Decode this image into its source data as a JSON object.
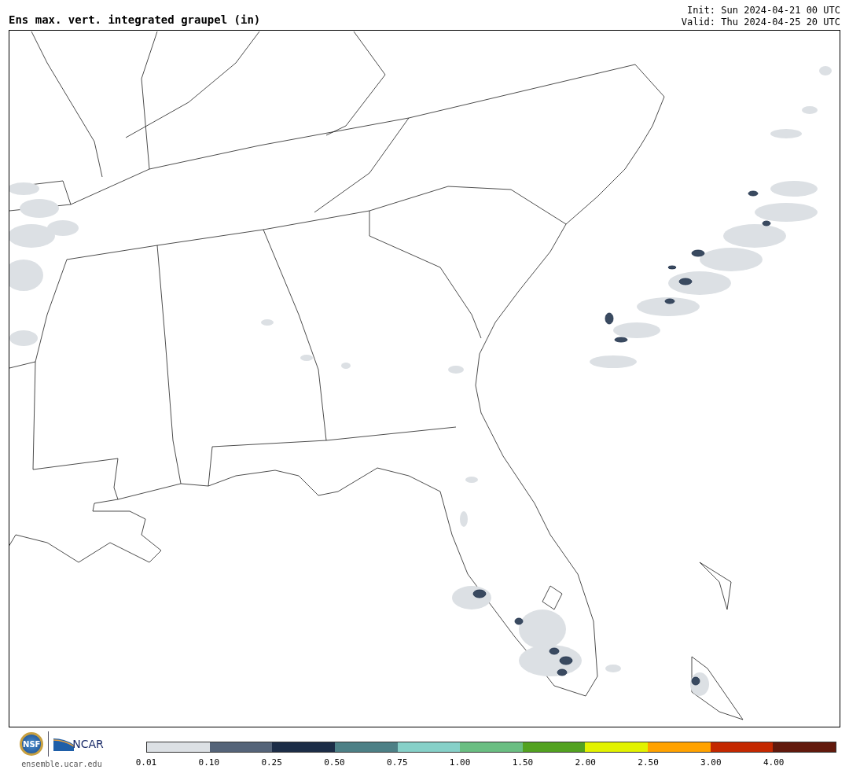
{
  "title": "Ens max. vert. integrated graupel (in)",
  "init": "Init: Sun 2024-04-21 00 UTC",
  "valid": "Valid: Thu 2024-04-25 20 UTC",
  "logos": {
    "nsf": "NSF",
    "ncar": "NCAR",
    "site": "ensemble.ucar.edu"
  },
  "colorbar": {
    "bins": [
      {
        "color": "#dce0e4"
      },
      {
        "color": "#556479"
      },
      {
        "color": "#1c2d47"
      },
      {
        "color": "#4d8086"
      },
      {
        "color": "#86d0c8"
      },
      {
        "color": "#6abe82"
      },
      {
        "color": "#52a220"
      },
      {
        "color": "#e2f200"
      },
      {
        "color": "#ffa200"
      },
      {
        "color": "#c42800"
      },
      {
        "color": "#62190c"
      }
    ],
    "ticks": [
      "0.01",
      "0.10",
      "0.25",
      "0.50",
      "0.75",
      "1.00",
      "1.50",
      "2.00",
      "2.50",
      "3.00",
      "4.00"
    ]
  }
}
